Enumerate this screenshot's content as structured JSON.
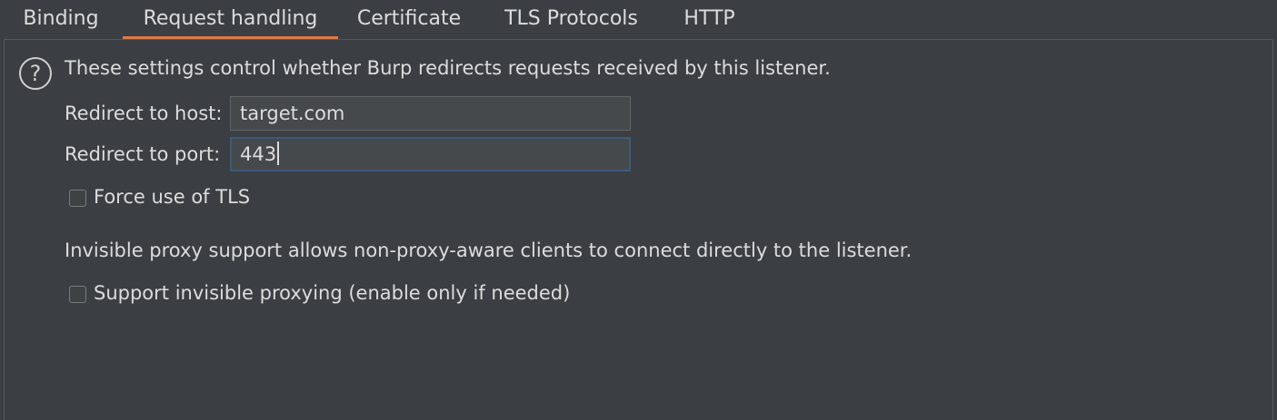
{
  "tabs": [
    {
      "label": "Binding"
    },
    {
      "label": "Request handling"
    },
    {
      "label": "Certificate"
    },
    {
      "label": "TLS Protocols"
    },
    {
      "label": "HTTP"
    }
  ],
  "active_tab": "Request handling",
  "help_icon_glyph": "?",
  "intro_text": "These settings control whether Burp redirects requests received by this listener.",
  "redirect_host": {
    "label": "Redirect to host:",
    "value": "target.com"
  },
  "redirect_port": {
    "label": "Redirect to port:",
    "value": "443"
  },
  "force_tls": {
    "label": "Force use of TLS",
    "checked": false
  },
  "invisible_note": "Invisible proxy support allows non-proxy-aware clients to connect directly to the listener.",
  "invisible_proxy": {
    "label": "Support invisible proxying (enable only if needed)",
    "checked": false
  },
  "colors": {
    "background": "#3b3f43",
    "accent_underline": "#e07a47",
    "focused_border": "#3b5a78"
  }
}
